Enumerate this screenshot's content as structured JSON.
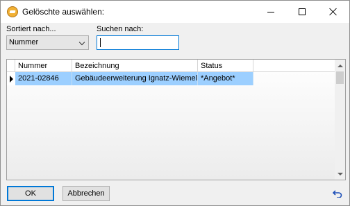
{
  "window": {
    "title": "Gelöschte auswählen:"
  },
  "filters": {
    "sort_label": "Sortiert nach...",
    "sort_value": "Nummer",
    "search_label": "Suchen nach:",
    "search_value": ""
  },
  "table": {
    "columns": [
      "Nummer",
      "Bezeichnung",
      "Status"
    ],
    "rows": [
      {
        "nummer": "2021-02846",
        "bezeichnung": "Gebäudeerweiterung Ignatz-Wiemel",
        "status": "*Angebot*"
      }
    ]
  },
  "footer": {
    "ok_label": "OK",
    "cancel_label": "Abbrechen"
  },
  "colors": {
    "selection": "#9ccfff",
    "focus": "#0078d7",
    "app_icon": "#f2b134"
  },
  "icons": {
    "app": "app-icon",
    "minimize": "minimize-icon",
    "maximize": "maximize-icon",
    "close": "close-icon",
    "sort_dropdown": "chevron-down-icon",
    "row_pointer": "row-pointer-icon",
    "undo": "undo-icon"
  }
}
